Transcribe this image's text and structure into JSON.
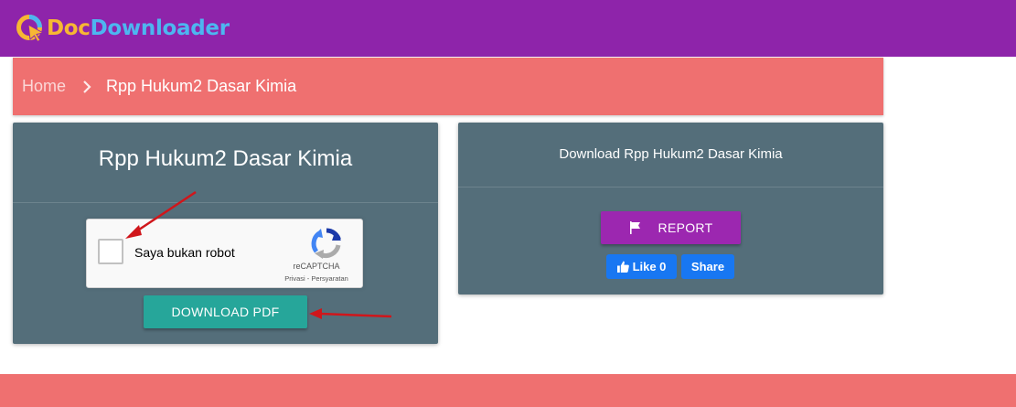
{
  "header": {
    "logo_part1": "Doc",
    "logo_part2": "Downloader",
    "logo_icon": "doc-downloader-logo-icon"
  },
  "breadcrumb": {
    "home": "Home",
    "separator_icon": "chevron-right-icon",
    "current": "Rpp Hukum2 Dasar Kimia"
  },
  "document_card": {
    "title": "Rpp Hukum2 Dasar Kimia",
    "recaptcha": {
      "label": "Saya bukan robot",
      "brand": "reCAPTCHA",
      "links": "Privasi - Persyaratan",
      "checked": false
    },
    "download_label": "DOWNLOAD PDF"
  },
  "download_card": {
    "title": "Download Rpp Hukum2 Dasar Kimia",
    "report_label": "REPORT",
    "report_icon": "flag-icon",
    "like_label": "Like 0",
    "share_label": "Share"
  },
  "colors": {
    "header": "#8e24aa",
    "breadcrumb_bg": "#ef7070",
    "card_bg": "#546e7a",
    "download_button": "#26a69a",
    "report_button": "#9c27b0",
    "facebook": "#1877f2",
    "annotation_arrow": "#d0161b"
  }
}
